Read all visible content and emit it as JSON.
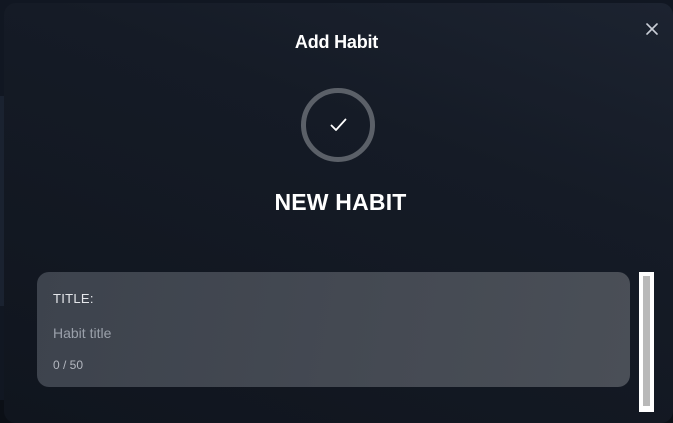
{
  "modal": {
    "title": "Add Habit",
    "close_icon": "close-icon",
    "status_icon": "checkmark-icon",
    "heading": "NEW HABIT"
  },
  "form": {
    "title_field": {
      "label": "TITLE:",
      "value": "",
      "placeholder": "Habit title",
      "char_count": "0 / 50"
    }
  },
  "colors": {
    "modal_background": "#151b26",
    "card_background": "#454a53",
    "icon_ring": "#5b6068",
    "text_primary": "#ffffff",
    "placeholder_text": "#9aa0aa"
  }
}
